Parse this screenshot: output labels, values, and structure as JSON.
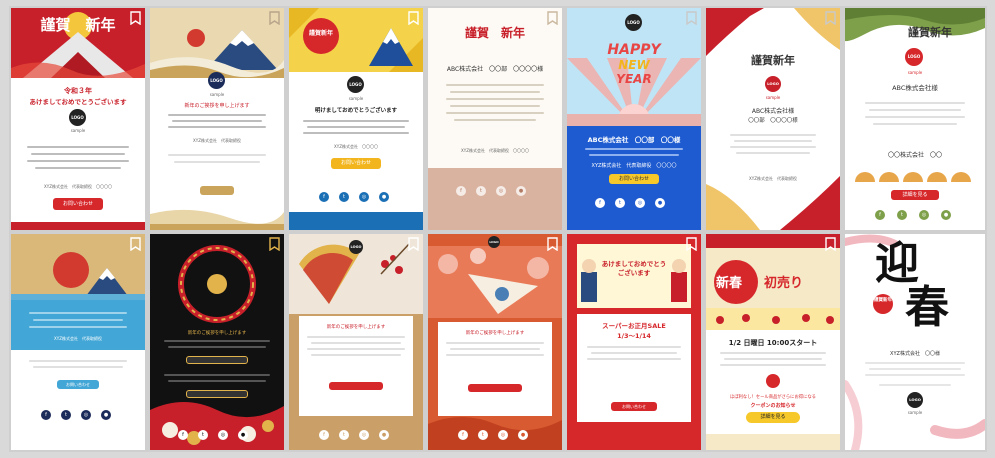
{
  "tiles": [
    {
      "title": "謹賀　新年",
      "line1": "令和３年",
      "line2": "あけましておめでとうございます",
      "logo": "LOGO",
      "logo_sub": "sample",
      "company": "XYZ株式会社　代表取締役　〇〇〇〇",
      "cta": "お問い合わせ"
    },
    {
      "logo": "LOGO",
      "logo_sub": "sample",
      "line1": "新年のご挨拶を申し上げます",
      "company": "XYZ株式会社　代表取締役"
    },
    {
      "title": "謹賀新年",
      "logo": "LOGO",
      "logo_sub": "sample",
      "line1": "明けましておめでとうございます",
      "company": "XYZ株式会社　〇〇〇〇",
      "cta": "お問い合わせ"
    },
    {
      "title": "謹賀　新年",
      "line1": "ABC株式会社　〇〇部　〇〇〇〇様",
      "company": "XYZ株式会社　代表取締役　〇〇〇〇"
    },
    {
      "logo": "LOGO",
      "headline1": "HAPPY",
      "headline2": "NEW",
      "headline3": "YEAR",
      "line1": "ABC株式会社　〇〇部　〇〇様",
      "company": "XYZ株式会社　代表取締役　〇〇〇〇",
      "cta": "お問い合わせ"
    },
    {
      "title": "謹賀新年",
      "logo": "LOGO",
      "logo_sub": "sample",
      "line1": "ABC株式会社様",
      "line2": "〇〇部　〇〇〇〇様",
      "company": "XYZ株式会社　代表取締役"
    },
    {
      "title": "謹賀新年",
      "logo": "LOGO",
      "logo_sub": "sample",
      "line1": "ABC株式会社様",
      "company": "〇〇株式会社　〇〇",
      "cta": "詳細を見る"
    },
    {
      "company": "XYZ株式会社　代表取締役",
      "cta": "お問い合わせ"
    },
    {
      "line1": "新年のご挨拶を申し上げます"
    },
    {
      "logo": "LOGO",
      "logo_sub": "sample",
      "line1": "新年のご挨拶を申し上げます"
    },
    {
      "logo": "LOGO",
      "logo_sub": "sample",
      "line1": "新年のご挨拶を申し上げます"
    },
    {
      "headline": "あけましておめでとうございます",
      "sale1": "スーパーお正月SALE",
      "sale2": "1/3〜1/14",
      "cta": "お問い合わせ"
    },
    {
      "headline1": "新春",
      "headline2": "初売り",
      "date_line": "1/2 日曜日 10:00スタート",
      "coupon1": "ほぼ利なし！セール商品がさらにお得になる",
      "coupon2": "クーポンのお知らせ",
      "cta": "詳細を見る"
    },
    {
      "headline1": "迎",
      "headline2": "春",
      "badge": "謹賀新年",
      "company": "XYZ株式会社　〇〇様",
      "logo": "LOGO",
      "logo_sub": "sample"
    }
  ],
  "icons": {
    "bookmark": "bookmark-icon",
    "social": [
      "facebook-icon",
      "twitter-icon",
      "instagram-icon",
      "line-icon"
    ],
    "social_glyphs": [
      "f",
      "t",
      "◎",
      "●"
    ]
  },
  "colors": {
    "red": "#d6272b",
    "gold": "#e2b34b",
    "navy": "#1b2b5a",
    "blue": "#1a56c4",
    "cream": "#f6eee0",
    "black": "#111111",
    "green": "#7fa04a",
    "orange": "#d85a30"
  }
}
